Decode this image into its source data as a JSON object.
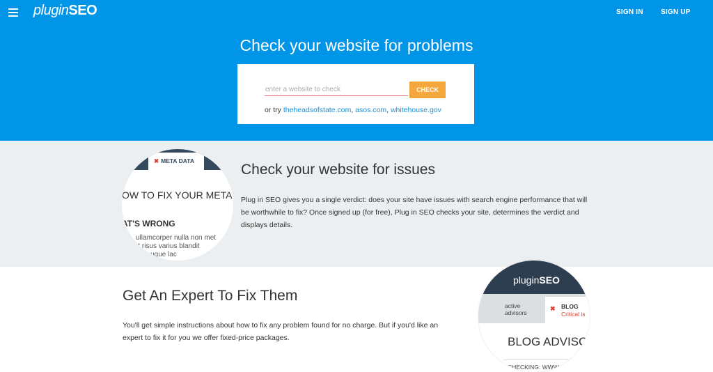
{
  "header": {
    "logo_plug": "plugin",
    "logo_seo": "SEO",
    "sign_in": "SIGN IN",
    "sign_up": "SIGN UP",
    "menu_icon": "hamburger-icon"
  },
  "hero": {
    "title": "Check your website for problems",
    "input_placeholder": "enter a website to check",
    "check_button": "CHECK",
    "or_try": "or try",
    "examples": [
      "theheadsofstate.com",
      "asos.com",
      "whitehouse.gov"
    ],
    "sep1": ",",
    "sep2": ","
  },
  "section_issues": {
    "title": "Check your website for issues",
    "body": "Plug in SEO gives you a single verdict: does your site have issues with search engine performance that will be worthwhile to fix? Once signed up (for free), Plug in SEO checks your site, determines the verdict and displays details.",
    "image": {
      "tab_label": "META DATA",
      "heading": "OW TO FIX YOUR META",
      "subheading": "AT'S WRONG",
      "body_line1": "ullamcorper nulla non met",
      "body_line2": "rt risus varius blandit",
      "body_line3": "vel augue lac"
    }
  },
  "section_expert": {
    "title": "Get An Expert To Fix Them",
    "body": "You'll get simple instructions about how to fix any problem found for no charge. But if you'd like an expert to fix it for you we offer fixed-price packages.",
    "image": {
      "logo_plug": "plugin",
      "logo_seo": "SEO",
      "active_advisors": "active advisors",
      "blog_label": "BLOG",
      "critical_label": "Critical is",
      "heading": "BLOG ADVISC",
      "checking": "CHECKING: WWW.MYLI"
    }
  },
  "colors": {
    "hero_bg": "#0095e6",
    "button": "#f6a73b",
    "section_bg": "#eceff1",
    "link": "#1a8ed1"
  }
}
